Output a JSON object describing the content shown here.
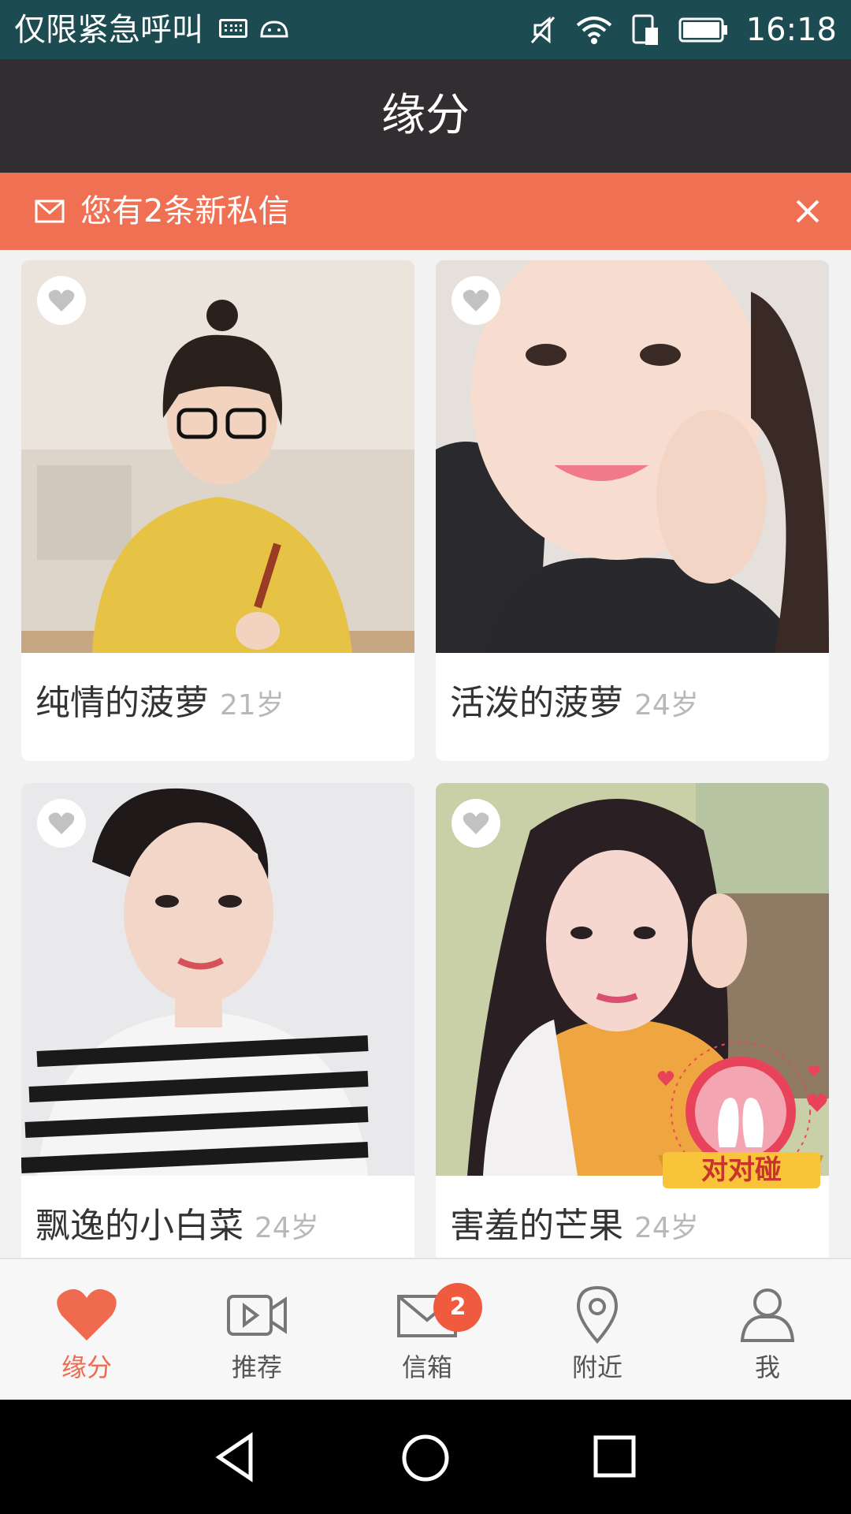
{
  "status_bar": {
    "carrier": "仅限紧急呼叫",
    "time": "16:18"
  },
  "header": {
    "title": "缘分"
  },
  "banner": {
    "message": "您有2条新私信"
  },
  "cards": [
    {
      "name": "纯情的菠萝",
      "age": "21岁"
    },
    {
      "name": "活泼的菠萝",
      "age": "24岁"
    },
    {
      "name": "飘逸的小白菜",
      "age": "24岁"
    },
    {
      "name": "害羞的芒果",
      "age": "24岁"
    }
  ],
  "match_badge": {
    "label": "对对碰"
  },
  "nav": {
    "items": [
      {
        "label": "缘分",
        "icon": "heart-icon",
        "active": true
      },
      {
        "label": "推荐",
        "icon": "video-icon"
      },
      {
        "label": "信箱",
        "icon": "mail-icon",
        "badge": "2"
      },
      {
        "label": "附近",
        "icon": "location-pin-icon"
      },
      {
        "label": "我",
        "icon": "person-icon"
      }
    ]
  },
  "colors": {
    "accent": "#f07054",
    "header": "#322d31",
    "status": "#1c4b52",
    "active": "#ef6a4f"
  }
}
